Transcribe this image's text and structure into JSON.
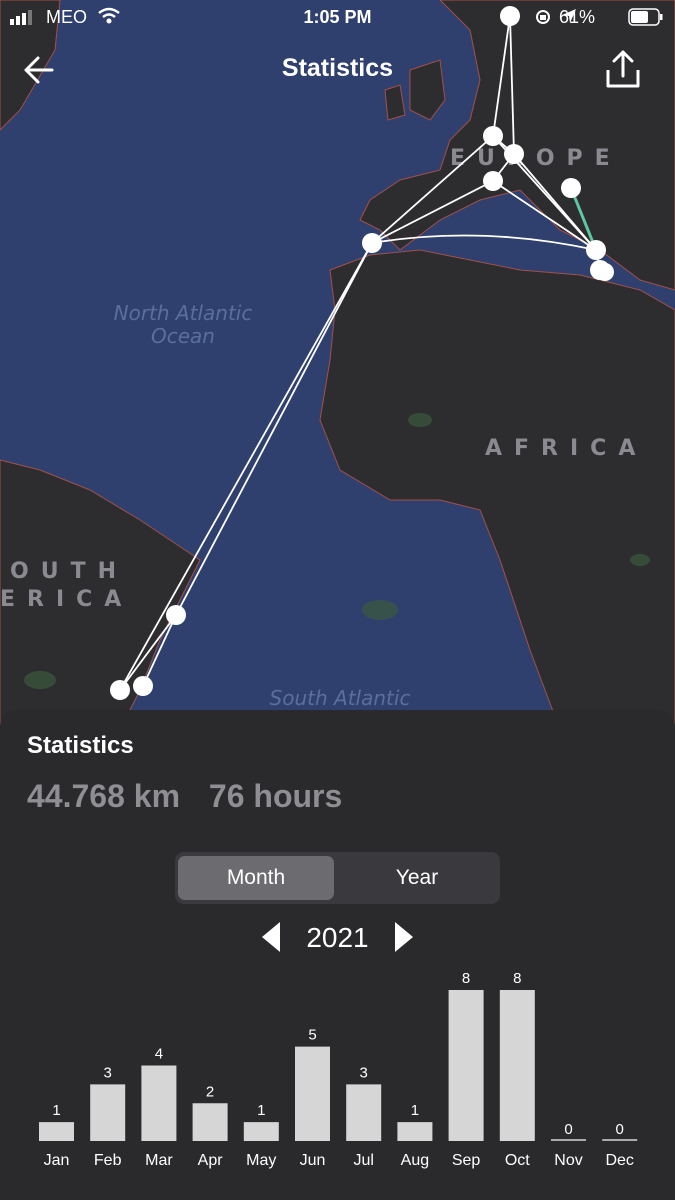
{
  "status_bar": {
    "carrier": "MEO",
    "time": "1:05 PM",
    "battery": "61%"
  },
  "nav": {
    "title": "Statistics",
    "back_icon": "arrow-left-icon",
    "share_icon": "share-icon"
  },
  "map": {
    "labels": {
      "north_atlantic": [
        "North Atlantic",
        "Ocean"
      ],
      "south_atlantic": "South Atlantic",
      "europe": "EUROPE",
      "africa": "AFRICA",
      "south_america": [
        "OUTH",
        "ERICA"
      ]
    },
    "colors": {
      "ocean": "#2f3f6e",
      "land": "#2d2d30",
      "route": "#ffffff",
      "route_highlight": "#5cc7a0",
      "marker": "#ffffff"
    }
  },
  "stats": {
    "title": "Statistics",
    "distance": "44.768 km",
    "duration": "76 hours"
  },
  "segment": {
    "month_label": "Month",
    "year_label": "Year",
    "selected": "Month"
  },
  "year_nav": {
    "year": "2021"
  },
  "chart_data": {
    "type": "bar",
    "categories": [
      "Jan",
      "Feb",
      "Mar",
      "Apr",
      "May",
      "Jun",
      "Jul",
      "Aug",
      "Sep",
      "Oct",
      "Nov",
      "Dec"
    ],
    "values": [
      1,
      3,
      4,
      2,
      1,
      5,
      3,
      1,
      8,
      8,
      0,
      0
    ],
    "ylim": [
      0,
      8
    ],
    "bar_color": "#d6d6d6"
  }
}
